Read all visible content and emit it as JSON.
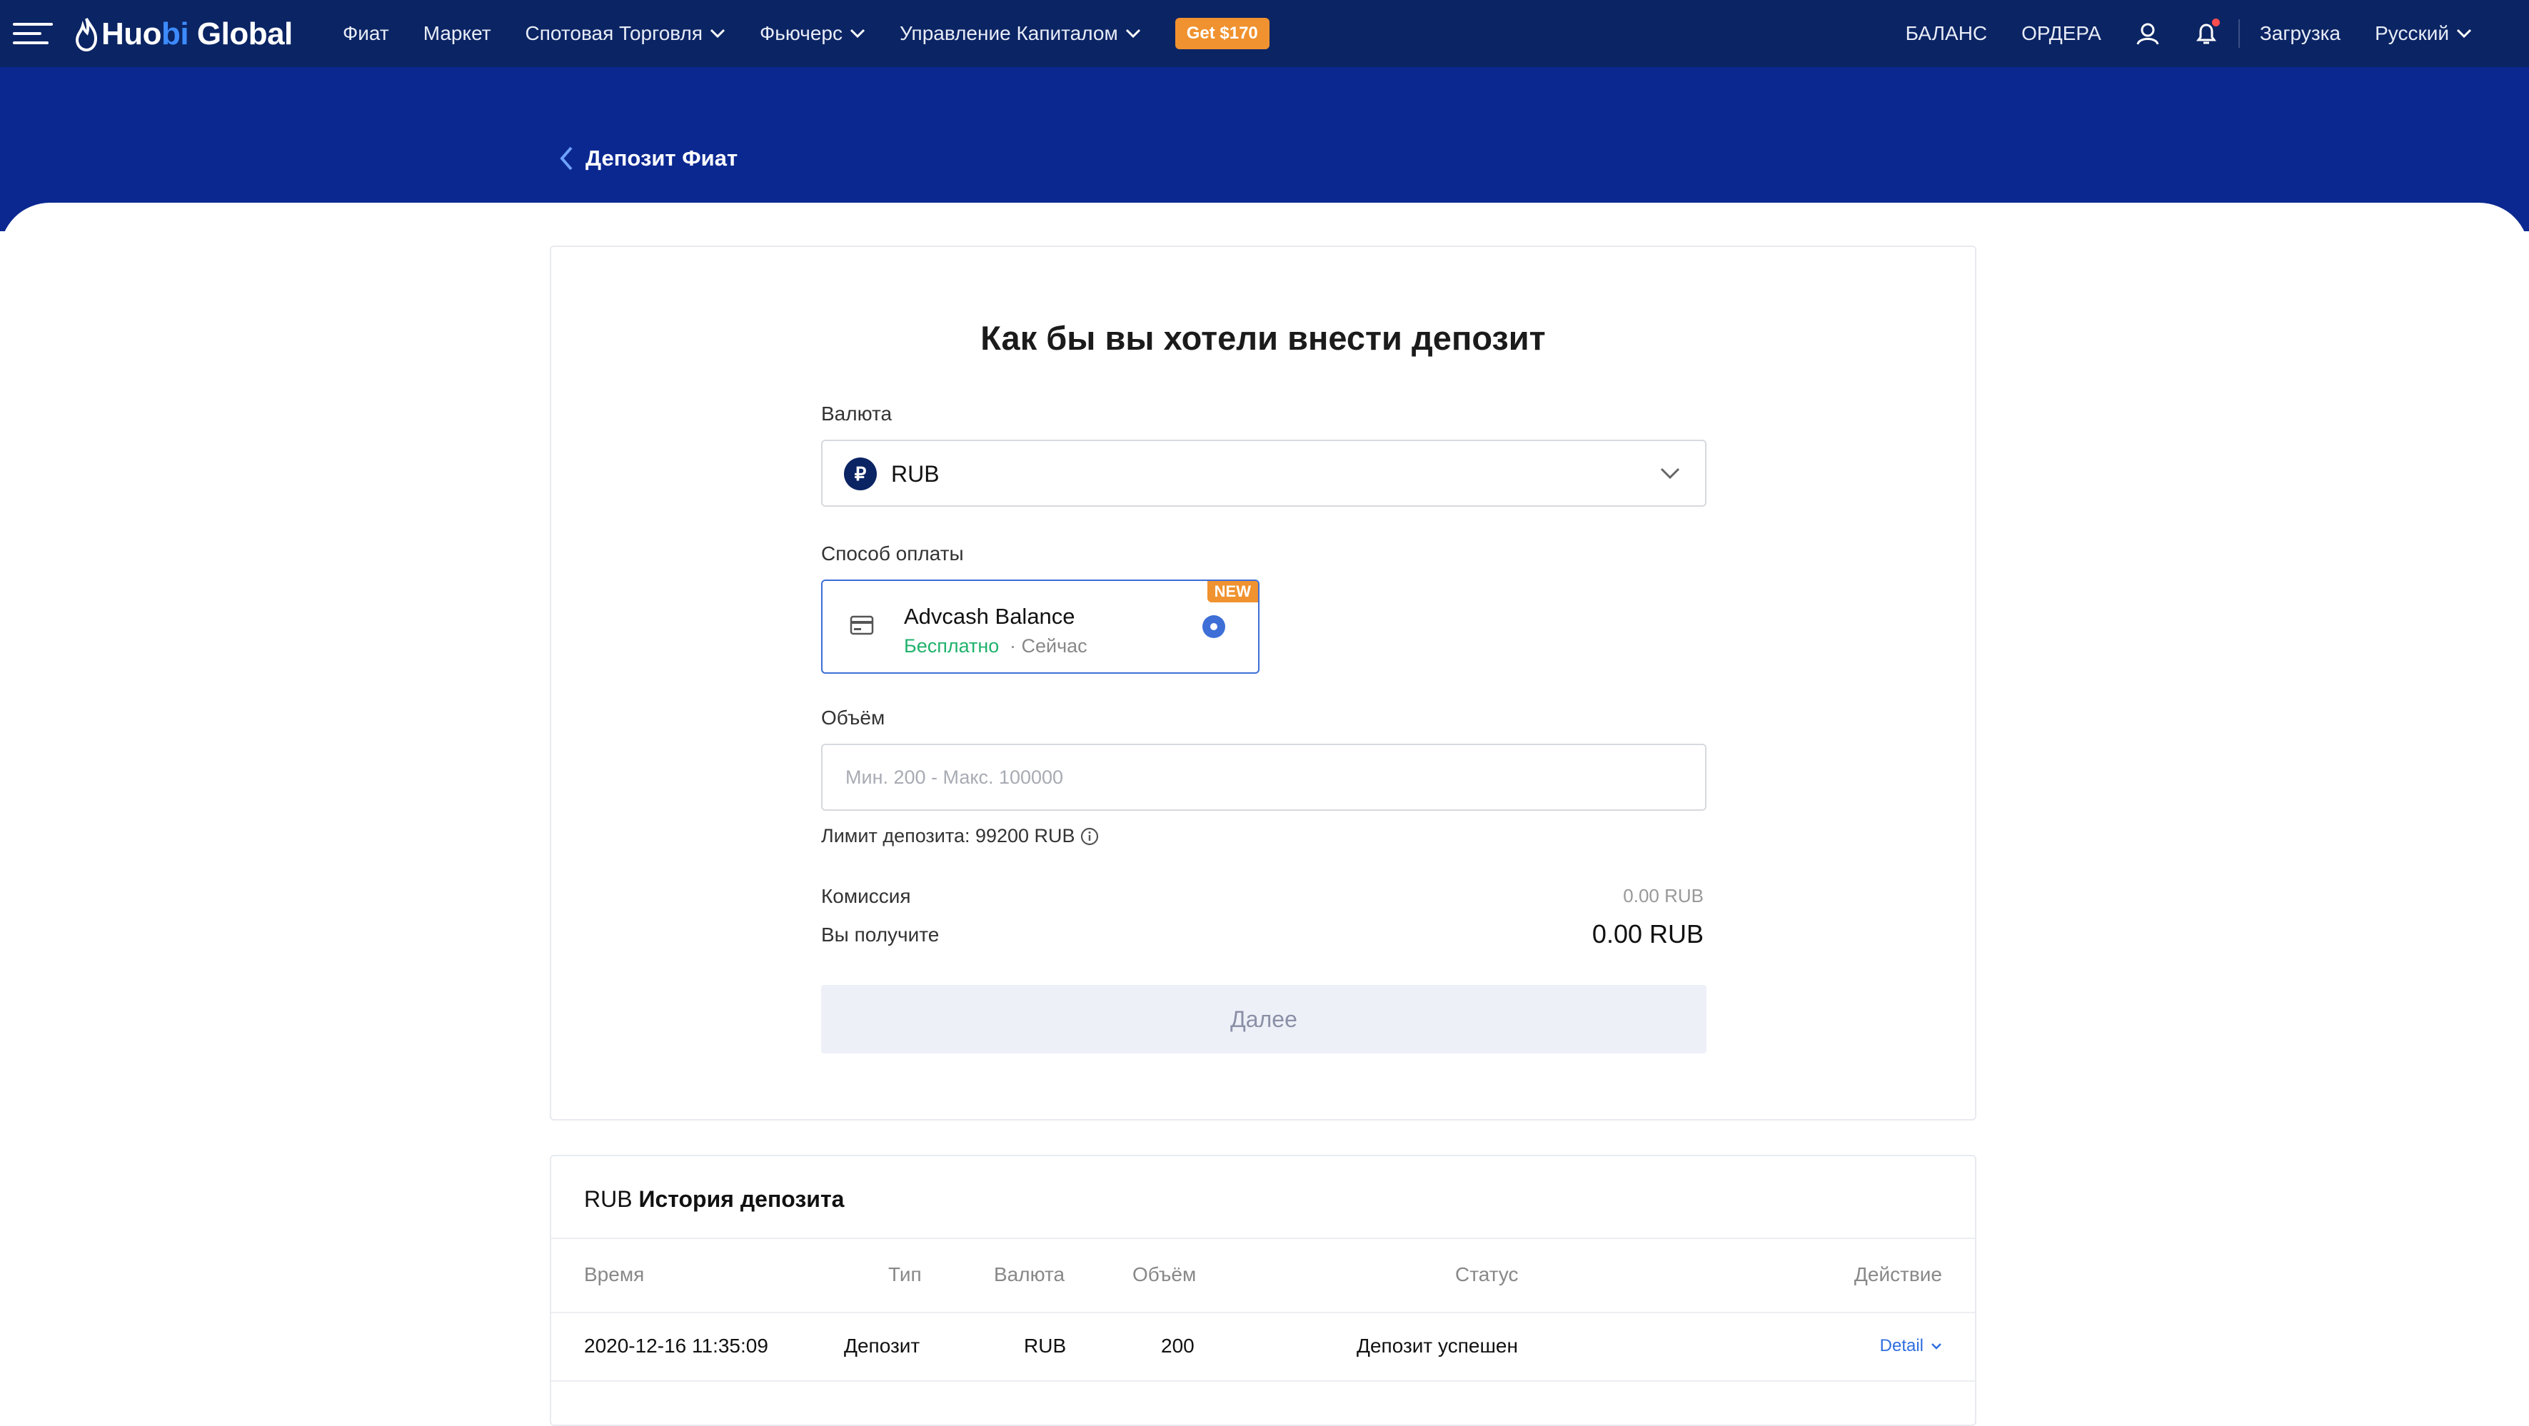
{
  "nav": {
    "logo_a": "Huo",
    "logo_b": "bi",
    "logo_c": " Global",
    "items": [
      "Фиат",
      "Маркет",
      "Спотовая Торговля",
      "Фьючерс",
      "Управление Капиталом"
    ],
    "promo": "Get $170",
    "balance": "БАЛАНС",
    "orders": "ОРДЕРА",
    "download": "Загрузка",
    "language": "Русский"
  },
  "page": {
    "back_title": "Депозит Фиат",
    "title": "Как бы вы хотели внести депозит"
  },
  "form": {
    "currency_label": "Валюта",
    "currency_symbol": "₽",
    "currency_value": "RUB",
    "method_label": "Способ оплаты",
    "method_badge": "NEW",
    "method_name": "Advcash Balance",
    "method_fee": "Бесплатно",
    "method_time": "· Сейчас",
    "amount_label": "Объём",
    "amount_placeholder": "Мин. 200 - Макс. 100000",
    "limit_text": "Лимит депозита: 99200 RUB",
    "fee_label": "Комиссия",
    "fee_value": "0.00 RUB",
    "receive_label": "Вы получите",
    "receive_value": "0.00 RUB",
    "next_label": "Далее"
  },
  "history": {
    "title_currency": "RUB",
    "title_text": " История депозита",
    "columns": [
      "Время",
      "Тип",
      "Валюта",
      "Объём",
      "Статус",
      "Действие"
    ],
    "rows": [
      {
        "time": "2020-12-16 11:35:09",
        "type": "Депозит",
        "currency": "RUB",
        "amount": "200",
        "status": "Депозит успешен",
        "action": "Detail"
      }
    ]
  },
  "colors": {
    "navbar": "#0b2463",
    "hero": "#0b2891",
    "accent": "#3d6fd6",
    "promo": "#f0922f",
    "success": "#20b26c"
  }
}
